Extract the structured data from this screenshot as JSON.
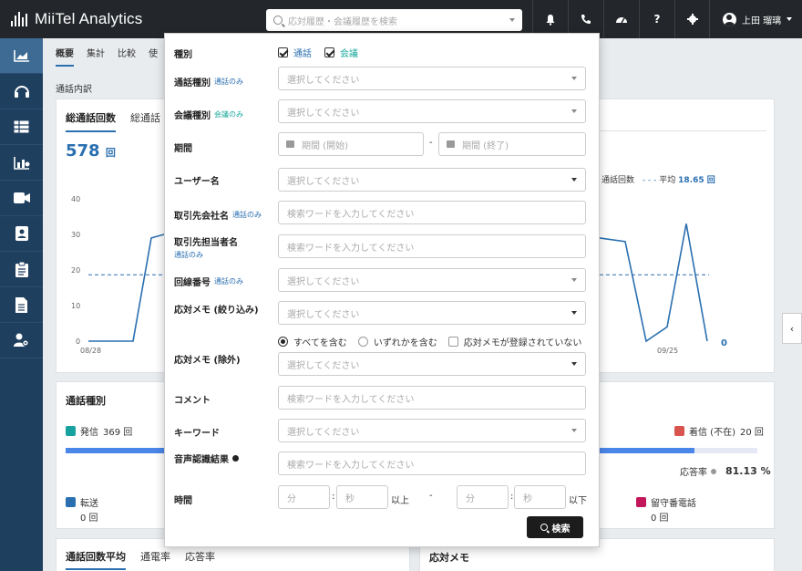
{
  "header": {
    "logo_text": "MiiTel Analytics",
    "search_placeholder": "応対履歴・会議履歴を検索",
    "user_name": "上田 瑠璃"
  },
  "icons": {
    "topbar": [
      "bell-icon",
      "phone-icon",
      "dashboard-icon",
      "help-icon",
      "gear-icon"
    ],
    "sidebar": [
      "analytics-icon",
      "headset-icon",
      "table-icon",
      "chart-icon",
      "video-icon",
      "contacts-icon",
      "clipboard-icon",
      "document-icon",
      "user-settings-icon"
    ]
  },
  "tabs": [
    "概要",
    "集計",
    "比較",
    "使"
  ],
  "section_title": "通話内訳",
  "card_total": {
    "tab_active": "総通話回数",
    "tab_other": "総通話",
    "value": "578",
    "unit": "回",
    "y_ticks": [
      "40",
      "30",
      "20",
      "10",
      "0"
    ],
    "x_label_first": "08/28",
    "x_label_right": "09/25",
    "legend_series": "通話回数",
    "legend_avg_label": "平均",
    "legend_avg_value": "18.65 回",
    "end_value": "0"
  },
  "chart_data": {
    "type": "line",
    "x_labels": [
      "08/28",
      "09/25"
    ],
    "ylim": [
      0,
      40
    ],
    "average": 18.65,
    "left_values": [
      0,
      0,
      0,
      0,
      29,
      30
    ],
    "right_values": [
      29,
      28,
      0,
      4,
      33,
      0
    ]
  },
  "card_types": {
    "title": "通話種別",
    "outgoing_label": "発信",
    "outgoing_count": "369 回",
    "missed_label": "着信 (不在)",
    "missed_count": "20 回",
    "answer_rate_label": "応答率",
    "answer_rate_value": "81.13 %",
    "transfer_label": "転送",
    "transfer_count": "0 回",
    "voicemail_label": "留守番電話",
    "voicemail_count": "0 回",
    "colors": {
      "outgoing": "#17a2a0",
      "missed": "#d9534f",
      "voicemail": "#c2185b",
      "transfer": "#2a6fb0"
    }
  },
  "card_avg": {
    "tab_active": "通話回数平均",
    "tab_2": "通電率",
    "tab_3": "応答率"
  },
  "card_memo": {
    "title": "応対メモ"
  },
  "filter": {
    "kind_label": "種別",
    "kind_call": "通話",
    "kind_meeting": "会議",
    "call_type_label": "通話種別",
    "call_only": "通話のみ",
    "meeting_type_label": "会議種別",
    "meeting_only": "会議のみ",
    "select_placeholder": "選択してください",
    "period_label": "期間",
    "period_start": "期間 (開始)",
    "period_end": "期間 (終了)",
    "period_sep": "-",
    "user_label": "ユーザー名",
    "company_label": "取引先会社名",
    "keyword_placeholder": "検索ワードを入力してください",
    "contact_label": "取引先担当者名",
    "line_label": "回線番号",
    "memo_include_label": "応対メモ (絞り込み)",
    "memo_all": "すべてを含む",
    "memo_any": "いずれかを含む",
    "memo_none": "応対メモが登録されていない",
    "memo_exclude_label": "応対メモ (除外)",
    "comment_label": "コメント",
    "keyword_label": "キーワード",
    "speech_label": "音声認識結果",
    "time_label": "時間",
    "minute": "分",
    "second": "秒",
    "colon": ":",
    "or_more": "以上",
    "or_less": "以下",
    "dash": "-",
    "search_button": "検索"
  },
  "colors": {
    "accent": "#2a6fb0",
    "teal": "#1aa89c",
    "topbar": "#23272b",
    "sidebar": "#1f3f5f"
  }
}
